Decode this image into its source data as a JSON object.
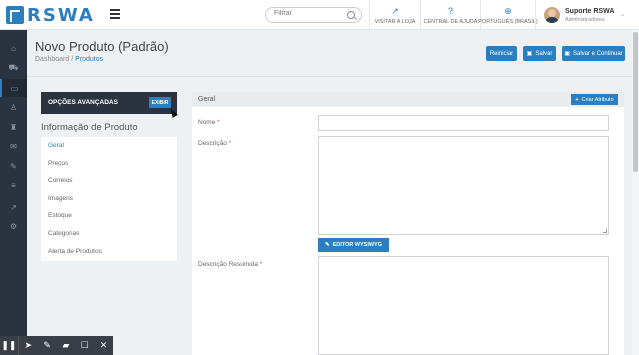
{
  "brand": {
    "logo_text": "RSWA"
  },
  "search": {
    "placeholder": "Filtrar"
  },
  "topnav": [
    {
      "label": "VISITAR A LOJA",
      "icon": "external-link-icon"
    },
    {
      "label": "CENTRAL DE AJUDA",
      "icon": "help-icon"
    },
    {
      "label": "PORTUGUÊS (BRASIL)",
      "icon": "globe-icon"
    }
  ],
  "user": {
    "name": "Suporte RSWA",
    "role": "Administradores"
  },
  "sidebar": {
    "items": [
      {
        "icon": "dashboard-icon"
      },
      {
        "icon": "cart-icon"
      },
      {
        "icon": "catalog-icon",
        "active": true
      },
      {
        "icon": "users-icon"
      },
      {
        "icon": "promotions-icon"
      },
      {
        "icon": "mail-icon"
      },
      {
        "icon": "edit-icon"
      },
      {
        "icon": "list-icon"
      },
      {
        "icon": "reports-icon"
      },
      {
        "icon": "settings-icon"
      }
    ]
  },
  "page": {
    "title": "Novo Produto (Padrão)",
    "breadcrumb": {
      "root": "Dashboard",
      "separator": "/",
      "current": "Produtos"
    }
  },
  "actions": {
    "reset": "Reiniciar",
    "save": "Salvar",
    "save_continue": "Salvar e Continuar"
  },
  "advanced": {
    "label": "OPÇÕES AVANÇADAS",
    "button": "EXIBIR"
  },
  "product_info": {
    "title": "Informação de Produto",
    "items": [
      "Geral",
      "Preços",
      "Correios",
      "Imagens",
      "Estoque",
      "Categorias",
      "Alerta de Produtos"
    ],
    "active": "Geral"
  },
  "form": {
    "section_title": "Geral",
    "create_attribute": "Criar Atributo",
    "name_label": "Nome",
    "description_label": "Descrição",
    "wysiwyg_button": "EDITOR WYSIWYG",
    "short_description_label": "Descrição Resumida",
    "required_mark": "*"
  },
  "colors": {
    "primary": "#2a7fc1",
    "sidebar": "#2c3340",
    "required": "#d9534f"
  }
}
